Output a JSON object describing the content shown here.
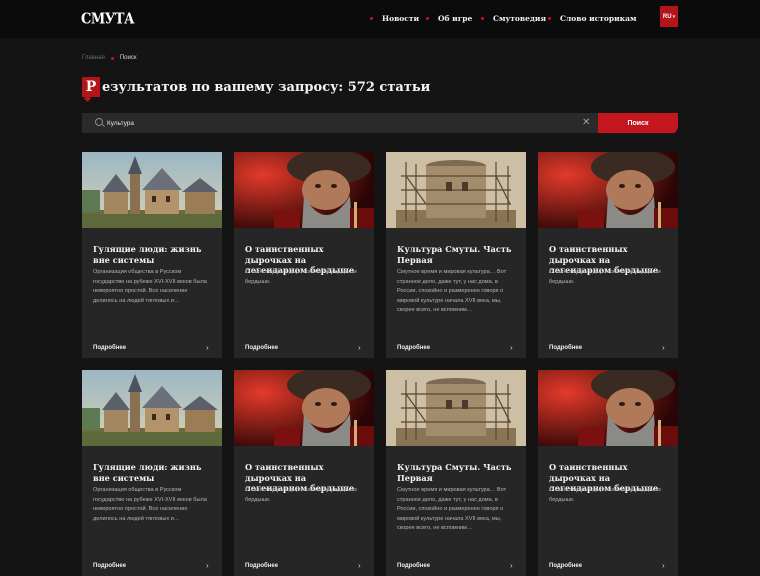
{
  "header": {
    "logo": "СМУТА",
    "nav": [
      "Новости",
      "Об игре",
      "Смутоведия",
      "Слово историкам"
    ],
    "lang": "RU"
  },
  "breadcrumb": {
    "home": "Главная",
    "current": "Поиск"
  },
  "title": {
    "cap": "Р",
    "rest": "езультатов по вашему запросу: 572 статьи"
  },
  "search": {
    "value": "Культура",
    "button": "Поиск"
  },
  "cards": [
    {
      "title": "Гулящие люди: жизнь вне системы",
      "description": "Организация общества в Русском государстве на рубеже XVI-XVII веков была невероятно простой. Все население делилось на людей тягловых и…",
      "more": "Подробнее",
      "image": "village"
    },
    {
      "title": "О таинственных дырочках на легендарном бердыше",
      "description": "О таинственных дырочках на легендарном бердыше.",
      "more": "Подробнее",
      "image": "warrior"
    },
    {
      "title": "Культура Смуты. Часть Первая",
      "description": "Смутное время и мировая культура… Вот странное дело, даже тут, у нас дома, в России, спокойно и размеренно говоря о мировой культуре начала XVII века, мы, скорее всего, не вспомним…",
      "more": "Подробнее",
      "image": "tower"
    },
    {
      "title": "О таинственных дырочках на легендарном бердыше",
      "description": "О таинственных дырочках на легендарном бердыше.",
      "more": "Подробнее",
      "image": "warrior"
    },
    {
      "title": "Гулящие люди: жизнь вне системы",
      "description": "Организация общества в Русском государстве на рубеже XVI-XVII веков была невероятно простой. Все население делилось на людей тягловых и…",
      "more": "Подробнее",
      "image": "village"
    },
    {
      "title": "О таинственных дырочках на легендарном бердыше",
      "description": "О таинственных дырочках на легендарном бердыше.",
      "more": "Подробнее",
      "image": "warrior"
    },
    {
      "title": "Культура Смуты. Часть Первая",
      "description": "Смутное время и мировая культура… Вот странное дело, даже тут, у нас дома, в России, спокойно и размеренно говоря о мировой культуре начала XVII века, мы, скорее всего, не вспомним…",
      "more": "Подробнее",
      "image": "tower"
    },
    {
      "title": "О таинственных дырочках на легендарном бердыше",
      "description": "О таинственных дырочках на легендарном бердыше.",
      "more": "Подробнее",
      "image": "warrior"
    }
  ],
  "colors": {
    "accent": "#c4161c",
    "background": "#141414",
    "card": "#262626",
    "header": "#0b0b0b"
  }
}
